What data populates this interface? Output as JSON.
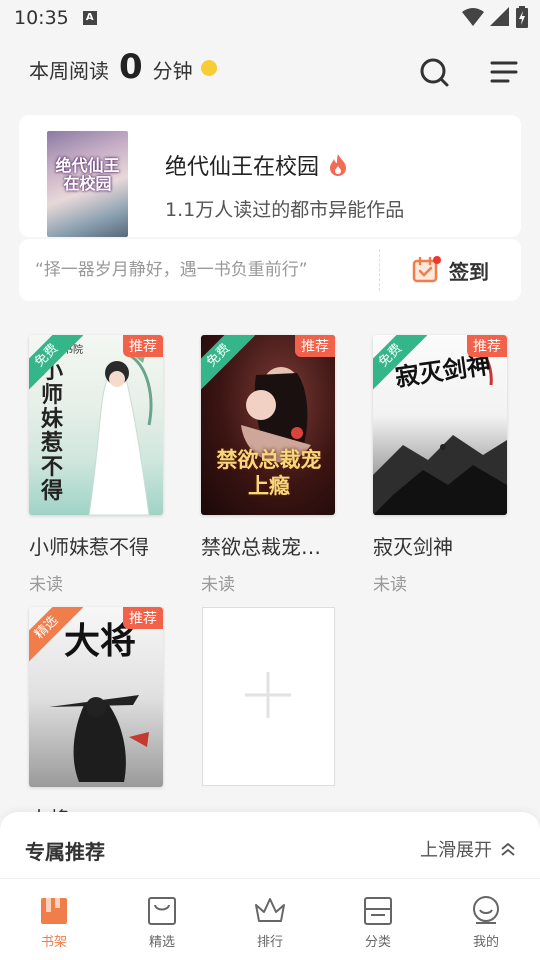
{
  "status_bar": {
    "time": "10:35",
    "a_badge": "A"
  },
  "header": {
    "reading_label": "本周阅读",
    "reading_minutes": "0",
    "minutes_unit": "分钟"
  },
  "featured": {
    "cover_text": "绝代仙王在校园",
    "title": "绝代仙王在校园",
    "subtitle": "1.1万人读过的都市异能作品"
  },
  "quote_bar": {
    "quote": "“择一器岁月静好，遇一书负重前行”",
    "signin_label": "签到"
  },
  "books": [
    {
      "title": "小师妹惹不得",
      "status": "未读",
      "ribbon": "免费",
      "tag": "推荐",
      "cover_text": "小师妹惹不得",
      "cover_publisher": "书院"
    },
    {
      "title": "禁欲总裁宠…",
      "status": "未读",
      "ribbon": "免费",
      "tag": "推荐",
      "cover_text": "禁欲总裁宠上瘾"
    },
    {
      "title": "寂灭剑神",
      "status": "未读",
      "ribbon": "免费",
      "tag": "推荐",
      "cover_text": "寂灭剑神"
    },
    {
      "title": "大将",
      "status": "",
      "ribbon": "精选",
      "tag": "推荐",
      "cover_text": "大将"
    }
  ],
  "recommend": {
    "title": "专属推荐",
    "expand_label": "上滑展开"
  },
  "bottom_nav": [
    {
      "label": "书架",
      "icon": "bookshelf-icon",
      "active": true
    },
    {
      "label": "精选",
      "icon": "bag-icon",
      "active": false
    },
    {
      "label": "排行",
      "icon": "crown-icon",
      "active": false
    },
    {
      "label": "分类",
      "icon": "category-icon",
      "active": false
    },
    {
      "label": "我的",
      "icon": "profile-icon",
      "active": false
    }
  ],
  "colors": {
    "accent": "#f17d4a",
    "tag_red": "#f2614a",
    "free_green": "#35b58a",
    "coin_yellow": "#f6cd34"
  }
}
